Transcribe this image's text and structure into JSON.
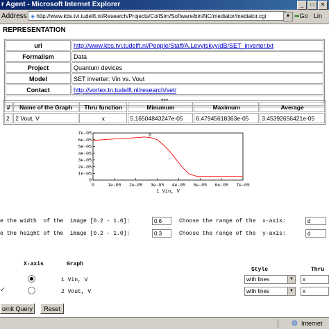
{
  "window": {
    "title": "r Agent - Microsoft Internet Explorer",
    "buttons": [
      "_",
      "□",
      "✕"
    ]
  },
  "address_bar": {
    "label": "Address",
    "url": "http://www.kbs.tvi.tudelft.nl/Research/Projects/CollSim/Software/bin/NC/mediator/mediator.cgi",
    "go_label": "Go",
    "links_label": "Lin"
  },
  "page": {
    "heading": "REPRESENTATION",
    "info": [
      {
        "label": "url",
        "value": "http://www.kbs.tvi.tudelft.nl/People/Staff/A.Levytskyy/dB/SET_inverter.txt",
        "link": true
      },
      {
        "label": "Formalism",
        "value": "Data",
        "link": false
      },
      {
        "label": "Project",
        "value": "Quantum devices",
        "link": false
      },
      {
        "label": "Model",
        "value": "SET inverter: Vin vs. Vout",
        "link": false
      },
      {
        "label": "Contact",
        "value": "http://vortex.tn.tudelft.nl/research/set/",
        "link": true
      }
    ],
    "separator": "***",
    "data_table": {
      "headers": [
        "#",
        "Name of the Graph",
        "Thru function",
        "Minumum",
        "Maximum",
        "Average"
      ],
      "rows": [
        [
          "2",
          "2 Vout, V",
          "x",
          "5.16504843247e-05",
          "6.47945618363e-05",
          "3.45392656421e-05"
        ]
      ]
    }
  },
  "chart_data": {
    "type": "line",
    "xlabel": "1 Vin, V",
    "ylabel": "",
    "xlim": [
      0,
      7e-05
    ],
    "ylim": [
      0,
      7e-05
    ],
    "x_ticks": [
      "0",
      "1e-05",
      "2e-05",
      "3e-05",
      "4e-05",
      "5e-05",
      "6e-05",
      "7e-05"
    ],
    "y_ticks": [
      "0",
      "1e-05",
      "2e-05",
      "3e-05",
      "4e-05",
      "5e-05",
      "6e-05",
      "7e-05"
    ],
    "series": [
      {
        "name": "",
        "color": "#ff0000",
        "points": [
          [
            0.0,
            5.9e-05
          ],
          [
            5e-06,
            6e-05
          ],
          [
            1e-05,
            6.1e-05
          ],
          [
            1.5e-05,
            6.2e-05
          ],
          [
            2e-05,
            6.3e-05
          ],
          [
            2.4e-05,
            6.4e-05
          ],
          [
            2.7e-05,
            6.3e-05
          ],
          [
            3e-05,
            6e-05
          ],
          [
            3.3e-05,
            5.2e-05
          ],
          [
            3.6e-05,
            4.2e-05
          ],
          [
            3.9e-05,
            3e-05
          ],
          [
            4.2e-05,
            1.8e-05
          ],
          [
            4.5e-05,
            9e-06
          ],
          [
            4.8e-05,
            6e-06
          ],
          [
            5e-05,
            5.5e-06
          ],
          [
            6e-05,
            5.5e-06
          ],
          [
            7e-05,
            5.5e-06
          ]
        ]
      }
    ],
    "marker_label": "0"
  },
  "controls": {
    "width_label": "e the width  of the  image [0.2 - 1.0]:",
    "width_value": "0.6",
    "height_label": "e the height of the  image [0.2 - 1.0]:",
    "height_value": "0.3",
    "xrange_label": "Choose the range of the  x-axis:",
    "xrange_value": "d",
    "yrange_label": "Choose the range of the  y-axis:",
    "yrange_value": "d"
  },
  "graph_select": {
    "xaxis_header": "X-axis",
    "graph_header": "Graph",
    "style_header": "Style",
    "thru_header": "Thru",
    "rows": [
      {
        "label": "1 Vin, V",
        "style": "with lines",
        "thru": "x",
        "checked": false,
        "radio": true
      },
      {
        "label": "2 Vout, V",
        "style": "with lines",
        "thru": "x",
        "checked": true,
        "radio": false
      }
    ]
  },
  "buttons": {
    "submit": "omit Query",
    "reset": "Reset"
  },
  "status": {
    "zone": "Internet"
  }
}
